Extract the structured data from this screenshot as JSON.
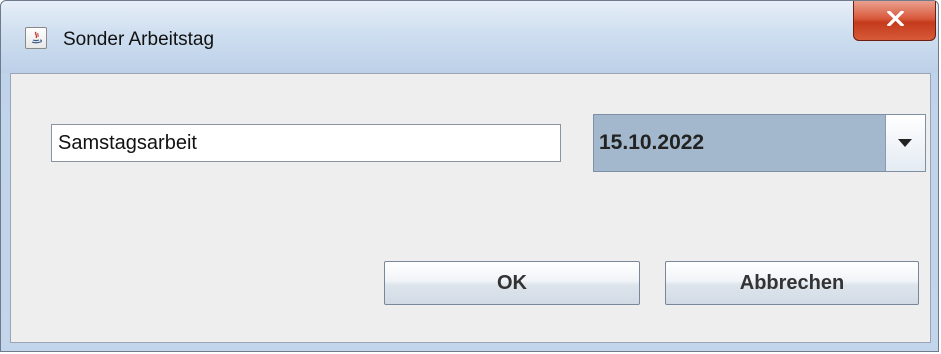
{
  "window": {
    "title": "Sonder Arbeitstag",
    "icon": "java-app-icon",
    "close_icon": "close-icon"
  },
  "form": {
    "name_field": {
      "value": "Samstagsarbeit"
    },
    "date_combo": {
      "selected_value": "15.10.2022",
      "arrow_icon": "triangle-down-icon"
    }
  },
  "buttons": {
    "ok_label": "OK",
    "cancel_label": "Abbrechen"
  },
  "colors": {
    "close_button": "#c43a1c",
    "combo_background": "#a3b8cc",
    "dialog_background": "#eeeeee"
  }
}
